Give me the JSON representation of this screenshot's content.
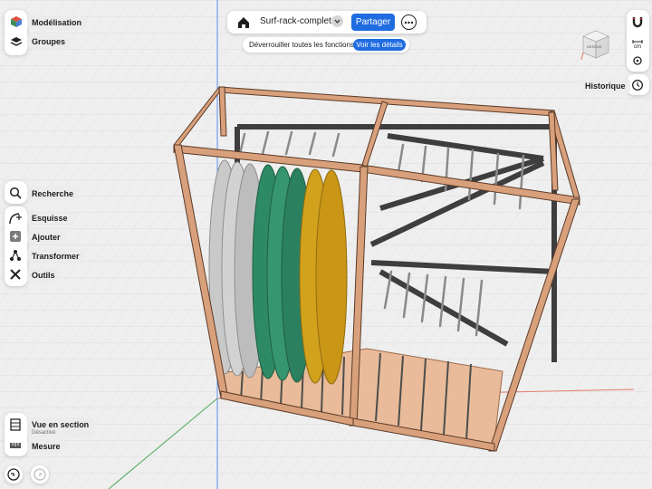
{
  "app": {
    "accent": "#1f6be0"
  },
  "header": {
    "document_title": "Surf-rack-complet",
    "share_label": "Partager",
    "icons": {
      "home": "home-icon",
      "dropdown": "chevron-down-icon",
      "more": "more-options-icon"
    }
  },
  "unlock_banner": {
    "text": "Déverrouiller toutes les fonctions",
    "button_label": "Voir les détails"
  },
  "left_top": [
    {
      "label": "Modélisation",
      "icon": "modeling-cube-icon"
    },
    {
      "label": "Groupes",
      "icon": "layers-icon"
    }
  ],
  "tools": {
    "search_label": "Recherche",
    "items": [
      {
        "label": "Esquisse",
        "icon": "sketch-icon"
      },
      {
        "label": "Ajouter",
        "icon": "add-icon"
      },
      {
        "label": "Transformer",
        "icon": "transform-icon"
      },
      {
        "label": "Outils",
        "icon": "tools-icon"
      }
    ]
  },
  "bottom": {
    "section_view": {
      "label": "Vue en section",
      "status": "Désactivé"
    },
    "measure_label": "Mesure",
    "undo_icon": "undo-icon",
    "redo_icon": "redo-icon"
  },
  "right": {
    "unit": "cm",
    "history_label": "Historique",
    "icons": [
      "magnet-icon",
      "units-icon",
      "view-target-icon",
      "history-clock-icon"
    ]
  },
  "viewcube": {
    "face_label": "DESSUS"
  }
}
